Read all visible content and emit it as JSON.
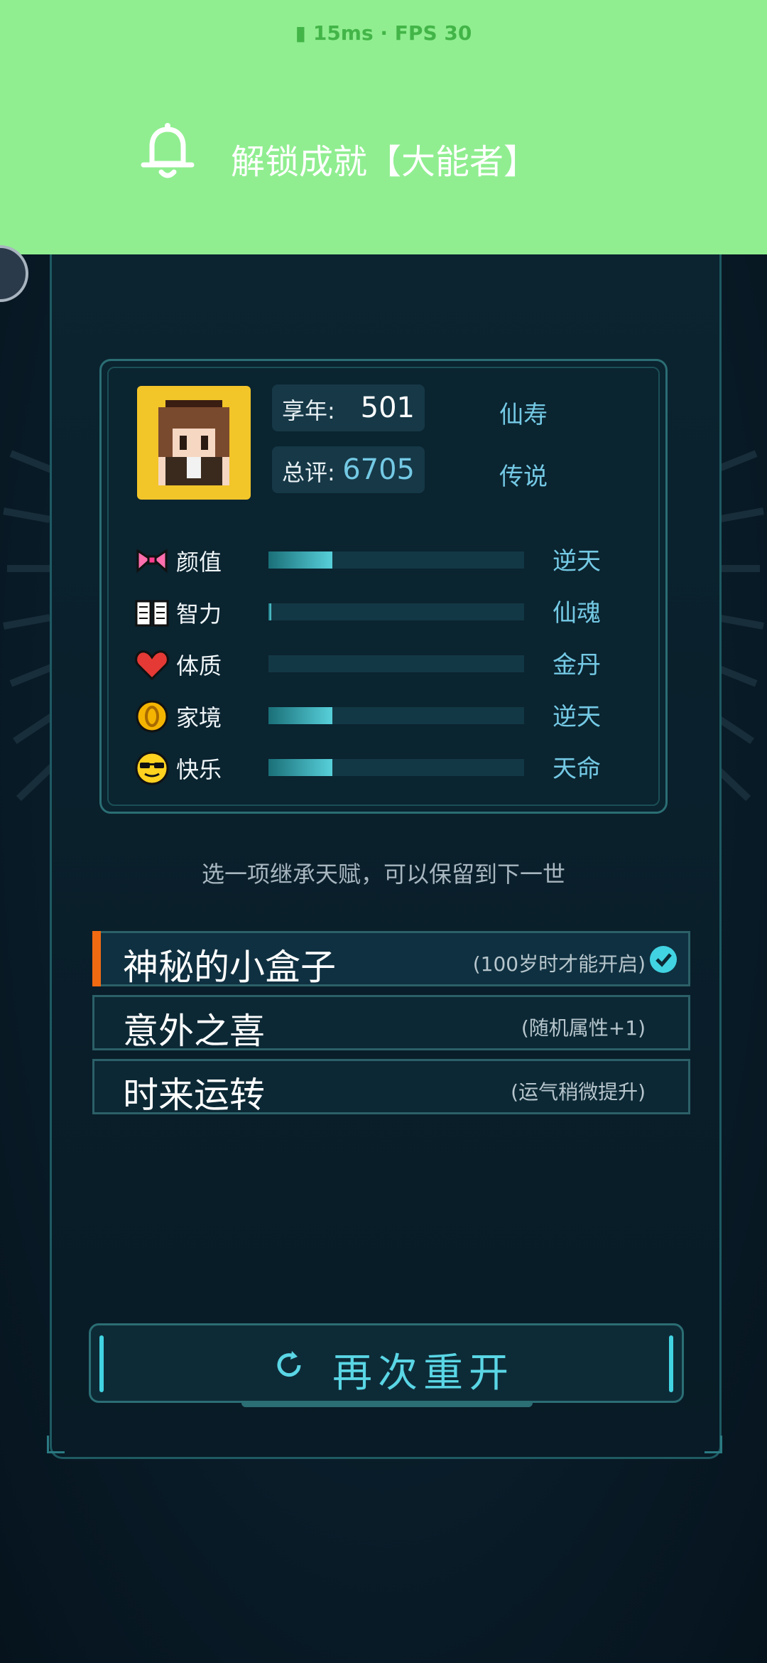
{
  "perf": {
    "ping": "15ms",
    "fps": "FPS 30"
  },
  "notification": {
    "text": "解锁成就【大能者】"
  },
  "profile": {
    "age_label": "享年:",
    "age_value": "501",
    "age_grade": "仙寿",
    "score_label": "总评:",
    "score_value": "6705",
    "score_grade": "传说"
  },
  "attributes": [
    {
      "label": "颜值",
      "grade": "逆天",
      "fill": 0.25,
      "icon": "bow-icon"
    },
    {
      "label": "智力",
      "grade": "仙魂",
      "fill": 0.01,
      "icon": "book-icon"
    },
    {
      "label": "体质",
      "grade": "金丹",
      "fill": 0.0,
      "icon": "heart-icon"
    },
    {
      "label": "家境",
      "grade": "逆天",
      "fill": 0.25,
      "icon": "coin-icon"
    },
    {
      "label": "快乐",
      "grade": "天命",
      "fill": 0.25,
      "icon": "sunglasses-face-icon"
    }
  ],
  "hint": "选一项继承天赋，可以保留到下一世",
  "talents": [
    {
      "name": "神秘的小盒子",
      "desc": "(100岁时才能开启)",
      "selected": true
    },
    {
      "name": "意外之喜",
      "desc": "(随机属性+1)",
      "selected": false
    },
    {
      "name": "时来运转",
      "desc": "(运气稍微提升)",
      "selected": false
    }
  ],
  "restart_label": "再次重开",
  "colors": {
    "accent": "#41d3e2",
    "selected_marker": "#f06a12",
    "notification_bg": "#90ee90",
    "grade_text": "#74c9e4"
  }
}
